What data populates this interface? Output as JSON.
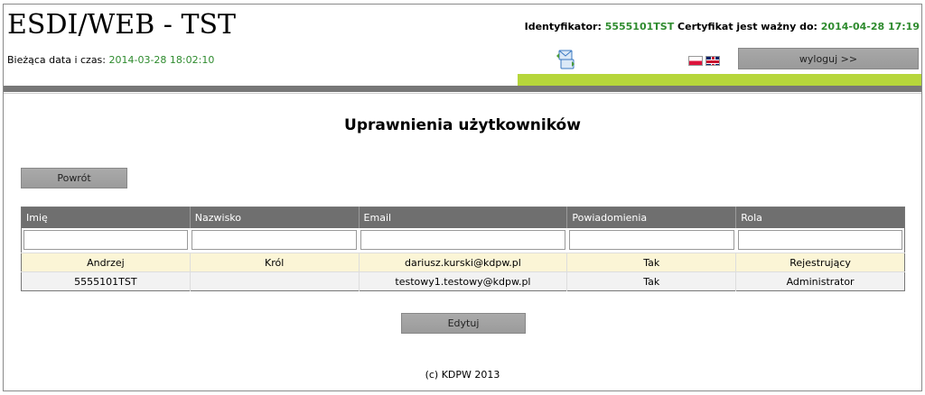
{
  "header": {
    "app_title": "ESDI/WEB - TST",
    "datetime_label": "Bieżąca data i czas:",
    "datetime_value": "2014-03-28 18:02:10",
    "identifier_label": "Identyfikator:",
    "identifier_value": "5555101TST",
    "cert_label": "Certyfikat jest ważny do:",
    "cert_value": "2014-04-28 17:19",
    "logout_label": "wyloguj >>",
    "icons": {
      "messages": "message-exchange-icon",
      "lang_pl": "flag-pl-icon",
      "lang_en": "flag-gb-icon"
    }
  },
  "page": {
    "title": "Uprawnienia użytkowników",
    "back_label": "Powrót",
    "edit_label": "Edytuj"
  },
  "table": {
    "columns": [
      "Imię",
      "Nazwisko",
      "Email",
      "Powiadomienia",
      "Rola"
    ],
    "filters": [
      "",
      "",
      "",
      "",
      ""
    ],
    "rows": [
      [
        "Andrzej",
        "Król",
        "dariusz.kurski@kdpw.pl",
        "Tak",
        "Rejestrujący"
      ],
      [
        "5555101TST",
        "",
        "testowy1.testowy@kdpw.pl",
        "Tak",
        "Administrator"
      ]
    ]
  },
  "footer": {
    "text": "(c) KDPW 2013"
  },
  "colors": {
    "accent_green": "#2e8b2e",
    "bar_green": "#b6d63b",
    "header_gray": "#6f6f6f",
    "row_highlight": "#fbf5d6"
  }
}
